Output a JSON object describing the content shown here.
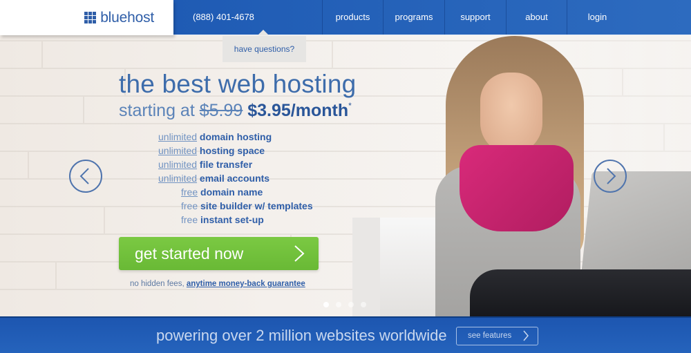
{
  "brand": {
    "name": "bluehost",
    "logo_icon": "grid-icon",
    "primary_color": "#2060b8",
    "accent_green": "#72c23c"
  },
  "header": {
    "phone": "(888) 401-4678",
    "questions_label": "have questions?",
    "nav": [
      {
        "label": "products"
      },
      {
        "label": "programs"
      },
      {
        "label": "support"
      },
      {
        "label": "about"
      },
      {
        "label": "login"
      }
    ]
  },
  "hero": {
    "headline": "the best web hosting",
    "starting_at": "starting at",
    "old_price": "$5.99",
    "new_price": "$3.95/month",
    "asterisk": "*",
    "features": [
      {
        "prefix": "unlimited",
        "prefix_link": true,
        "text": "domain hosting"
      },
      {
        "prefix": "unlimited",
        "prefix_link": true,
        "text": "hosting space"
      },
      {
        "prefix": "unlimited",
        "prefix_link": true,
        "text": "file transfer"
      },
      {
        "prefix": "unlimited",
        "prefix_link": true,
        "text": "email accounts"
      },
      {
        "prefix": "free",
        "prefix_link": true,
        "text": "domain name"
      },
      {
        "prefix": "free",
        "prefix_link": false,
        "text": "site builder w/ templates"
      },
      {
        "prefix": "free",
        "prefix_link": false,
        "text": "instant set-up"
      }
    ],
    "cta_label": "get started now",
    "guarantee_prefix": "no hidden fees,",
    "guarantee_link": "anytime money-back guarantee",
    "carousel": {
      "slides": 4,
      "active_index": 0
    },
    "prev_icon": "chevron-left-icon",
    "next_icon": "chevron-right-icon"
  },
  "footer_bar": {
    "tagline": "powering over 2 million websites worldwide",
    "see_features_label": "see features"
  }
}
